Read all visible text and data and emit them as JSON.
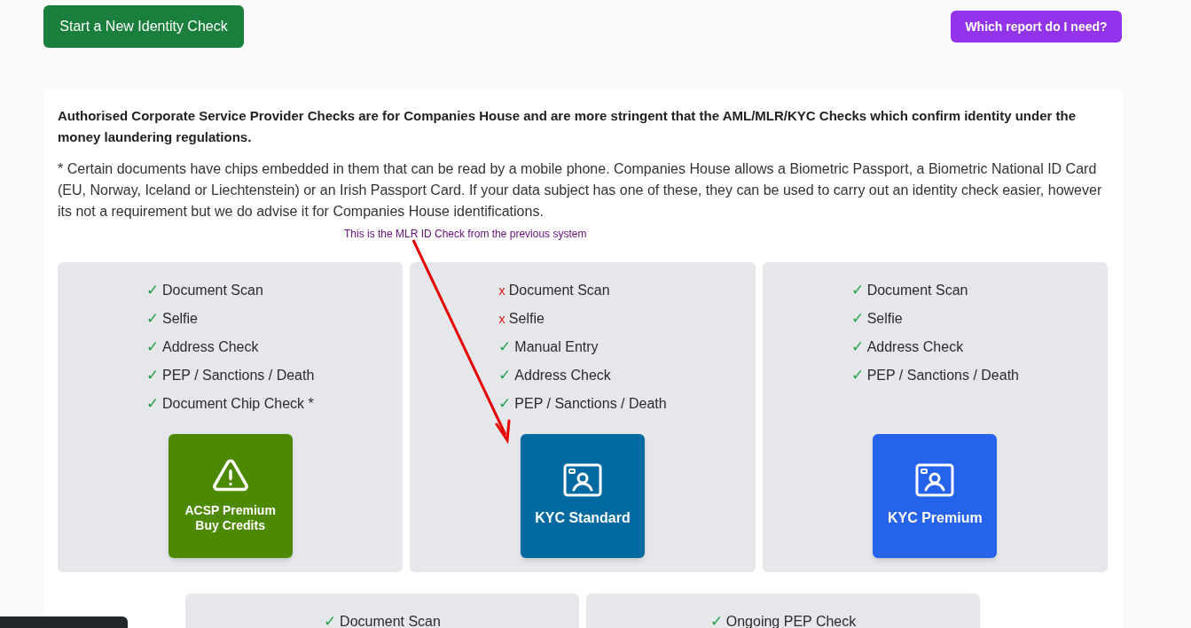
{
  "header": {
    "primary_button": "Start a New Identity Check",
    "help_button": "Which report do I need?"
  },
  "intro": {
    "bold_note": "Authorised Corporate Service Provider Checks are for Companies House and are more stringent that the AML/MLR/KYC Checks which confirm identity under the money laundering regulations.",
    "chip_note": "* Certain documents have chips embedded in them that can be read by a mobile phone. Companies House allows a Biometric Passport, a Biometric National ID Card (EU, Norway, Iceland or Liechtenstein) or an Irish Passport Card. If your data subject has one of these, they can be used to carry out an identity check easier, however its not a requirement but we do advise it for Companies House identifications."
  },
  "annotation": "This is the MLR ID Check from the previous system",
  "products": [
    {
      "features": [
        {
          "mark": "✓",
          "ok": true,
          "label": "Document Scan"
        },
        {
          "mark": "✓",
          "ok": true,
          "label": "Selfie"
        },
        {
          "mark": "✓",
          "ok": true,
          "label": "Address Check"
        },
        {
          "mark": "✓",
          "ok": true,
          "label": "PEP / Sanctions / Death"
        },
        {
          "mark": "✓",
          "ok": true,
          "label": "Document Chip Check *"
        }
      ],
      "tile": {
        "kind": "warning",
        "color": "#4d8a02",
        "title": "ACSP Premium",
        "subtitle": "Buy Credits"
      }
    },
    {
      "features": [
        {
          "mark": "x",
          "ok": false,
          "label": "Document Scan"
        },
        {
          "mark": "x",
          "ok": false,
          "label": "Selfie"
        },
        {
          "mark": "✓",
          "ok": true,
          "label": "Manual Entry"
        },
        {
          "mark": "✓",
          "ok": true,
          "label": "Address Check"
        },
        {
          "mark": "✓",
          "ok": true,
          "label": "PEP / Sanctions / Death"
        }
      ],
      "tile": {
        "kind": "id-card",
        "color": "#036aa1",
        "title": "KYC Standard"
      }
    },
    {
      "features": [
        {
          "mark": "✓",
          "ok": true,
          "label": "Document Scan"
        },
        {
          "mark": "✓",
          "ok": true,
          "label": "Selfie"
        },
        {
          "mark": "✓",
          "ok": true,
          "label": "Address Check"
        },
        {
          "mark": "✓",
          "ok": true,
          "label": "PEP / Sanctions / Death"
        }
      ],
      "tile": {
        "kind": "id-card",
        "color": "#2563eb",
        "title": "KYC Premium"
      }
    }
  ],
  "more_products": [
    {
      "features": [
        {
          "mark": "✓",
          "ok": true,
          "label": "Document Scan"
        }
      ]
    },
    {
      "features": [
        {
          "mark": "✓",
          "ok": true,
          "label": "Ongoing PEP Check"
        }
      ]
    }
  ]
}
